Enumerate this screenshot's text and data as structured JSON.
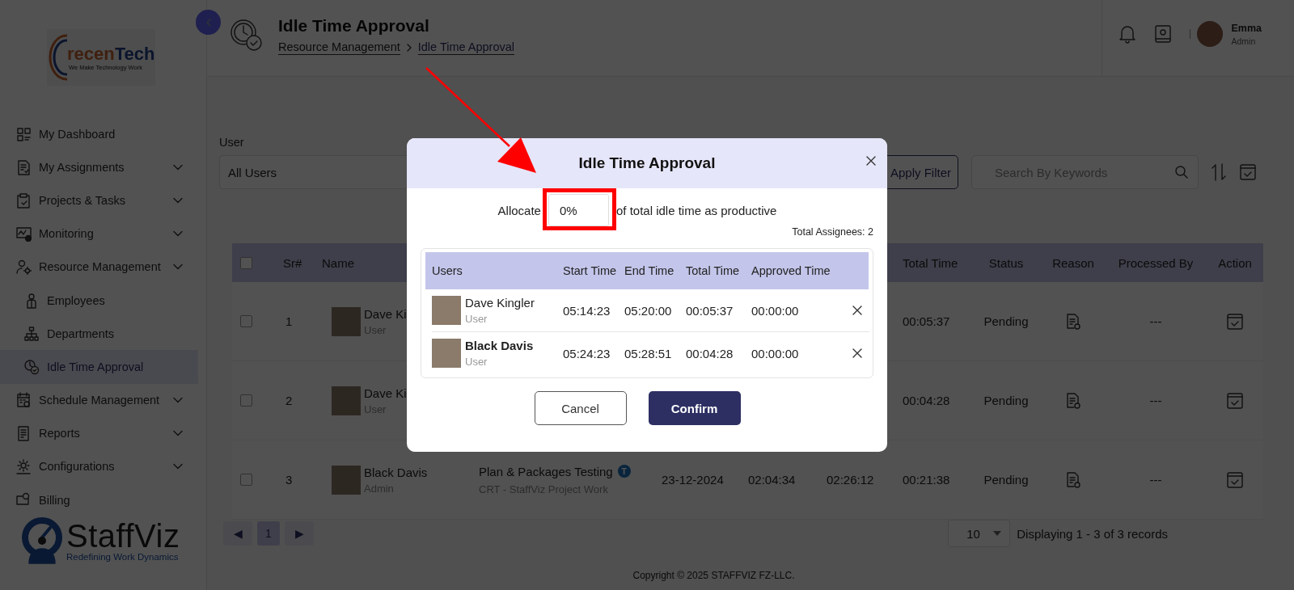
{
  "sidebar": {
    "logo": {
      "wordmark": "recenTech",
      "tagline": "We Make Technology Work"
    },
    "items": [
      {
        "label": "My Dashboard",
        "expandable": false,
        "selected": false
      },
      {
        "label": "My Assignments",
        "expandable": true,
        "selected": false
      },
      {
        "label": "Projects & Tasks",
        "expandable": true,
        "selected": false
      },
      {
        "label": "Monitoring",
        "expandable": true,
        "selected": false
      },
      {
        "label": "Resource Management",
        "expandable": true,
        "selected": false,
        "children": [
          {
            "label": "Employees",
            "selected": false
          },
          {
            "label": "Departments",
            "selected": false
          },
          {
            "label": "Idle Time Approval",
            "selected": true
          }
        ]
      },
      {
        "label": "Schedule Management",
        "expandable": true,
        "selected": false
      },
      {
        "label": "Reports",
        "expandable": true,
        "selected": false
      },
      {
        "label": "Configurations",
        "expandable": true,
        "selected": false
      },
      {
        "label": "Billing",
        "expandable": false,
        "selected": false
      }
    ],
    "brand": {
      "name": "StaffViz",
      "tagline": "Redefining Work Dynamics"
    }
  },
  "header": {
    "title": "Idle Time Approval",
    "breadcrumb": [
      "Resource Management",
      "Idle Time Approval"
    ],
    "user": {
      "name": "Emma",
      "role": "Admin"
    }
  },
  "filters": {
    "user_label": "User",
    "user_value": "All Users",
    "apply_button": "Apply Filter",
    "search_placeholder": "Search By Keywords"
  },
  "table": {
    "header_checkbox": {
      "checked": false
    },
    "columns": [
      "Sr#",
      "Name",
      "Total Time",
      "Status",
      "Reason",
      "Processed By",
      "Action"
    ],
    "rows": [
      {
        "checked": false,
        "sr": "1",
        "name": "Dave Ki",
        "role": "User",
        "total_time": "00:05:37",
        "status": "Pending",
        "processed_by": "---"
      },
      {
        "checked": false,
        "sr": "2",
        "name": "Dave Ki",
        "role": "User",
        "total_time": "00:04:28",
        "status": "Pending",
        "processed_by": "---"
      },
      {
        "checked": false,
        "sr": "3",
        "name": "Black Davis",
        "role": "Admin",
        "column_4": {
          "title": "Plan & Packages Testing",
          "badge": "T",
          "subtitle": "CRT - StaffViz Project Work"
        },
        "column_5": "23-12-2024",
        "column_6": "02:04:34",
        "column_7": "02:26:12",
        "total_time": "00:21:38",
        "status": "Pending",
        "processed_by": "---"
      }
    ]
  },
  "pagination": {
    "prev": "◀",
    "pages": [
      {
        "label": "1",
        "selected": true
      }
    ],
    "next": "▶",
    "page_size": "10",
    "summary": "Displaying 1 - 3 of 3 records"
  },
  "footer": "Copyright © 2025 STAFFVIZ FZ-LLC.",
  "modal": {
    "title": "Idle Time Approval",
    "allocate_prefix": "Allocate",
    "allocate_value": "0%",
    "allocate_suffix": "of total idle time as productive",
    "total_assignees": "Total Assignees: 2",
    "columns": [
      "Users",
      "Start Time",
      "End Time",
      "Total Time",
      "Approved Time"
    ],
    "rows": [
      {
        "name": "Dave Kingler",
        "bold": false,
        "role": "User",
        "start_time": "05:14:23",
        "end_time": "05:20:00",
        "total_time": "00:05:37",
        "approved_time": "00:00:00"
      },
      {
        "name": "Black Davis",
        "bold": true,
        "role": "User",
        "start_time": "05:24:23",
        "end_time": "05:28:51",
        "total_time": "00:04:28",
        "approved_time": "00:00:00"
      }
    ],
    "cancel_button": "Cancel",
    "confirm_button": "Confirm"
  }
}
